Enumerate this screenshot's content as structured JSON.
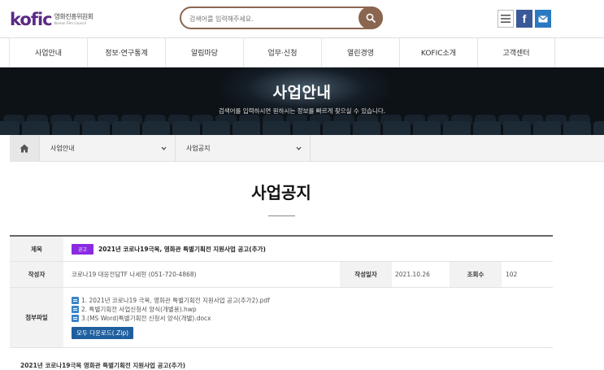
{
  "header": {
    "logo_mark": "kofic",
    "logo_kor": "영화진흥위원회",
    "logo_eng": "Korean Film Council",
    "search_placeholder": "검색어를 입력해주세요.",
    "icons": [
      "menu-icon",
      "facebook-icon",
      "mail-icon"
    ],
    "facebook_glyph": "f"
  },
  "nav": {
    "items": [
      "사업안내",
      "정보·연구통계",
      "알림마당",
      "업무·신청",
      "열린경영",
      "KOFIC소개",
      "고객센터"
    ]
  },
  "banner": {
    "title": "사업안내",
    "subtitle": "검색어를 입력하시면 원하시는 정보를 빠르게 찾으실 수 있습니다."
  },
  "breadcrumb": {
    "level1": "사업안내",
    "level2": "사업공지"
  },
  "page": {
    "title": "사업공지"
  },
  "detail": {
    "subject_label": "제목",
    "badge": "공고",
    "subject": "2021년 코로나19극복, 영화관 특별기획전 지원사업 공고(추가)",
    "author_label": "작성자",
    "author": "코로나19 대응전담TF 나세현 (051-720-4868)",
    "date_label": "작성일자",
    "date": "2021.10.26",
    "views_label": "조회수",
    "views": "102",
    "attach_label": "첨부파일",
    "files": [
      "1. 2021년 코로나19 극복, 영화관 특별기획전 지원사업 공고(추가2).pdf",
      "2. 특별기획전 사업신청서 양식(개별용).hwp",
      "3.(MS Word)특별기획전 신청서 양식(개별).docx"
    ],
    "download_all": "모두 다운로드(.Zip)"
  },
  "body": {
    "first_line": "2021년 코로나19극복 영화관 특별기획전 지원사업 공고(추가)"
  },
  "colors": {
    "brand": "#5b2a86",
    "search_border": "#8a6650",
    "badge": "#8a2be2",
    "download_button": "#1f5f9e",
    "banner_bg": "#0d1217"
  }
}
